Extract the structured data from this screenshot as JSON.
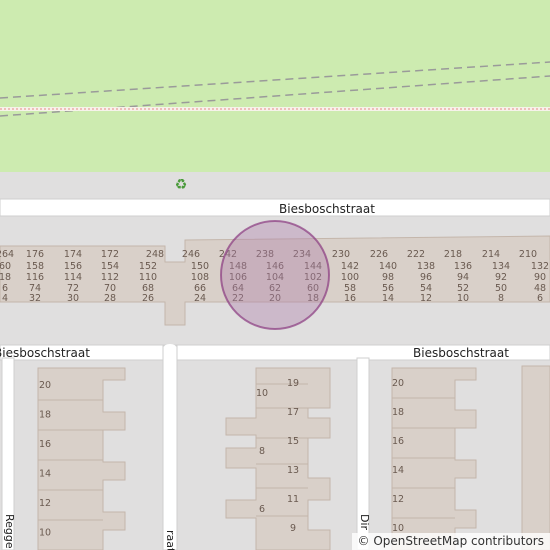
{
  "map": {
    "colors": {
      "grass": "#cdebb0",
      "land": "#e0dfdf",
      "building": "#d9d0c9",
      "building_outline": "#c4b6ab",
      "road": "#ffffff",
      "road_outline": "#cfcfcf",
      "highlight_fill": "#b07fa9",
      "highlight_stroke": "#8a3a80"
    },
    "recycling_icon": "♻",
    "streets": {
      "top": "Biesboschstraat",
      "middle_left": "Biesboschstraat",
      "middle_right": "Biesboschstraat",
      "left_vertical": "Regge",
      "center_vertical": "raat",
      "right_vertical": "Dir"
    },
    "house_numbers": {
      "block_rows": [
        [
          "264",
          "176",
          "174",
          "172",
          "248",
          "246",
          "242",
          "238",
          "234",
          "230",
          "226",
          "222",
          "218",
          "214",
          "210"
        ],
        [
          "60",
          "158",
          "156",
          "154",
          "152",
          "150",
          "148",
          "146",
          "144",
          "142",
          "140",
          "138",
          "136",
          "134",
          "132"
        ],
        [
          "18",
          "116",
          "114",
          "112",
          "110",
          "108",
          "106",
          "104",
          "102",
          "100",
          "98",
          "96",
          "94",
          "92",
          "90"
        ],
        [
          "6",
          "74",
          "72",
          "70",
          "68",
          "66",
          "64",
          "62",
          "60",
          "58",
          "56",
          "54",
          "52",
          "50",
          "48"
        ],
        [
          "4",
          "32",
          "30",
          "28",
          "26",
          "24",
          "22",
          "20",
          "18",
          "16",
          "14",
          "12",
          "10",
          "8",
          "6"
        ]
      ],
      "left_block": [
        "20",
        "18",
        "16",
        "14",
        "12",
        "10"
      ],
      "middle_block_right": [
        "19",
        "17",
        "15",
        "13",
        "11",
        "9"
      ],
      "middle_block_left": [
        "10",
        "8",
        "6"
      ],
      "right_block": [
        "20",
        "18",
        "16",
        "14",
        "12",
        "10"
      ]
    },
    "attribution": "© OpenStreetMap contributors"
  }
}
